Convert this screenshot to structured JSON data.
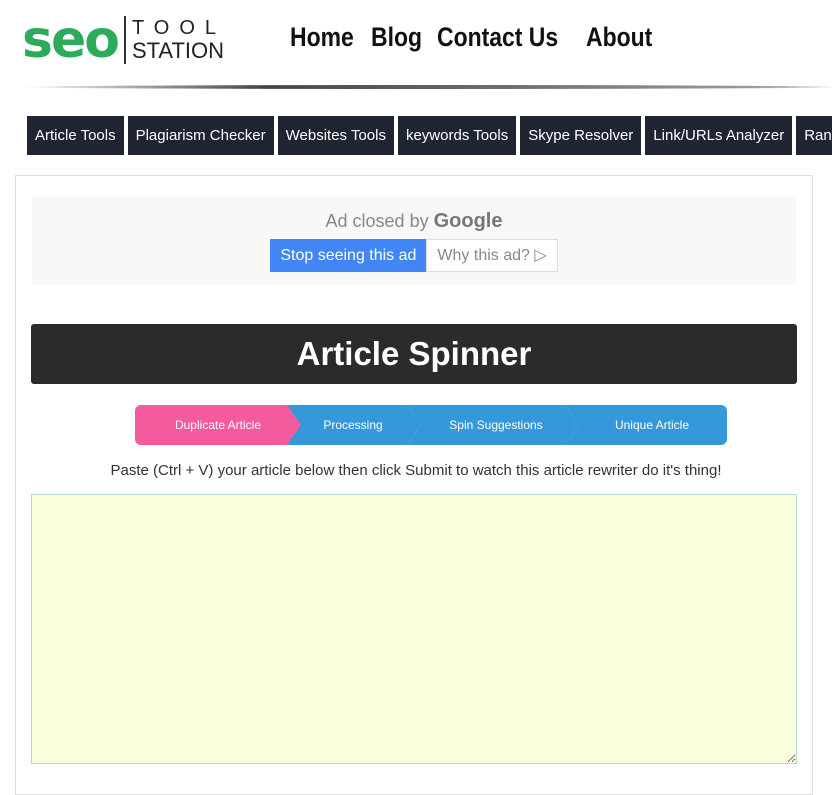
{
  "logo": {
    "seo": "seo",
    "tool": "TOOL",
    "station": "STATION"
  },
  "topnav": [
    "Home",
    "Blog",
    "Contact Us",
    "About"
  ],
  "menu": [
    "Article Tools",
    "Plagiarism Checker",
    "Websites Tools",
    "keywords Tools",
    "Skype Resolver",
    "Link/URLs Analyzer",
    "Ranke"
  ],
  "ad": {
    "closed_by": "Ad closed by",
    "google": "Google",
    "stop": "Stop seeing this ad",
    "why": "Why this ad? ▷"
  },
  "title": "Article Spinner",
  "steps": [
    {
      "label": "Duplicate Article",
      "color": "#f35b9e"
    },
    {
      "label": "Processing",
      "color": "#3498db"
    },
    {
      "label": "Spin Suggestions",
      "color": "#3498db"
    },
    {
      "label": "Unique Article",
      "color": "#3498db"
    }
  ],
  "instruction": "Paste (Ctrl + V) your article below then click Submit to watch this article rewriter do it's thing!",
  "textarea": {
    "value": ""
  }
}
